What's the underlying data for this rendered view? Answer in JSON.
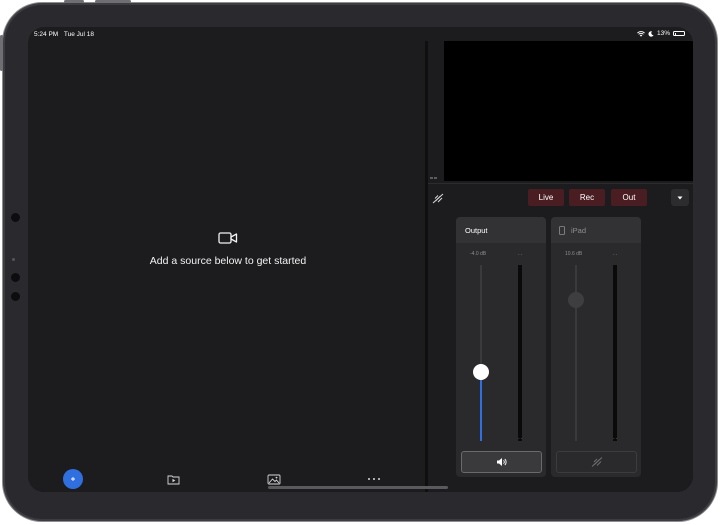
{
  "status_bar": {
    "time": "5:24 PM",
    "date": "Tue Jul 18",
    "battery": "13%"
  },
  "left_pane": {
    "empty_message": "Add a source below to get started",
    "toolbar": [
      "add-source-icon",
      "media-icon",
      "image-icon",
      "more-icon"
    ]
  },
  "right_pane": {
    "controls": {
      "live_label": "Live",
      "rec_label": "Rec",
      "out_label": "Out"
    },
    "mixer": {
      "output": {
        "name": "Output",
        "level": "-4.0 dB",
        "fader_level": 0.39,
        "muted": false
      },
      "ipad": {
        "name": "iPad",
        "level": "10.6 dB",
        "fader_level": 0.8,
        "muted": true
      }
    }
  },
  "colors": {
    "accent": "#2f6fe0",
    "record_button": "#4a1d22",
    "fader_active": "#2f6fe0"
  }
}
